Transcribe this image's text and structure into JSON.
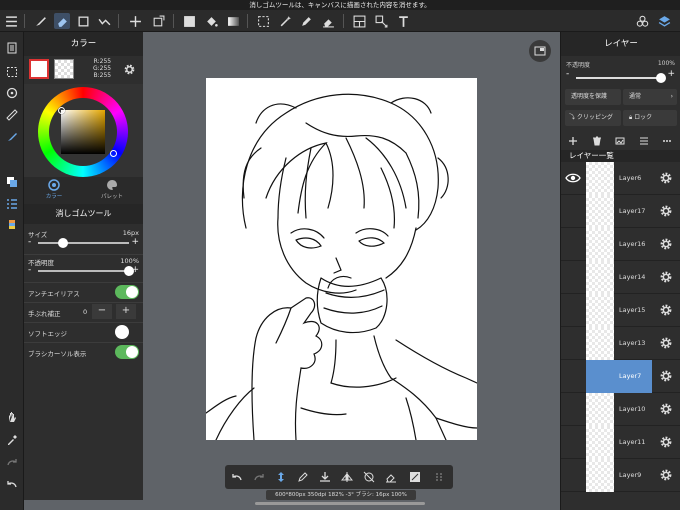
{
  "notice": "消しゴムツールは、キャンバスに描画された内容を消せます。",
  "toolbar": {
    "left_icons": [
      "menu-icon",
      "brush-icon",
      "eraser-icon",
      "shape-icon",
      "dot-tool-icon",
      "move-icon",
      "transform-icon",
      "fill-color-icon",
      "bucket-icon",
      "gradient-icon",
      "select-icon",
      "magic-wand-icon",
      "select-pen-icon",
      "select-eraser-icon",
      "frame-icon",
      "transform-alt-icon",
      "text-icon"
    ],
    "right_icons": [
      "materials-icon",
      "layers-icon"
    ]
  },
  "left_sidebar": [
    "layer-icon",
    "selection-icon",
    "redo-history-icon",
    "ruler-icon",
    "brush-settings-icon",
    "color-square-icon",
    "list-icon",
    "palette-icon",
    "hand-icon",
    "eyedropper-icon",
    "redo-icon",
    "undo-icon"
  ],
  "color_panel": {
    "title": "カラー",
    "main_color": "#ffffff",
    "r": "R:255",
    "g": "G:255",
    "b": "B:255",
    "tab_color": "カラー",
    "tab_palette": "パレット"
  },
  "tool_panel": {
    "title": "消しゴムツール",
    "size_label": "サイズ",
    "size_value": "16px",
    "size_fraction": 0.27,
    "opacity_label": "不透明度",
    "opacity_value": "100%",
    "opacity_fraction": 1.0,
    "antialias_label": "アンチエイリアス",
    "antialias_on": true,
    "stabilizer_label": "手ぶれ補正",
    "stabilizer_value": "0",
    "soft_edge_label": "ソフトエッジ",
    "soft_edge_on": false,
    "brush_cursor_label": "ブラシカーソル表示",
    "brush_cursor_on": true
  },
  "canvas": {
    "status": "600*800px 350dpi 182% -3° ブラシ: 16px 100%"
  },
  "layer_panel": {
    "title": "レイヤー",
    "opacity_label": "不透明度",
    "opacity_value": "100%",
    "protect_alpha": "透明度を保護",
    "blend_mode": "通常",
    "clipping": "クリッピング",
    "lock": "ロック",
    "list_title": "レイヤー一覧",
    "layers": [
      {
        "name": "Layer6"
      },
      {
        "name": "Layer17"
      },
      {
        "name": "Layer16"
      },
      {
        "name": "Layer14"
      },
      {
        "name": "Layer15"
      },
      {
        "name": "Layer13"
      },
      {
        "name": "Layer7",
        "selected": true
      },
      {
        "name": "Layer10"
      },
      {
        "name": "Layer11"
      },
      {
        "name": "Layer9"
      }
    ]
  },
  "colors": {
    "accent_selected": "#5a8fce",
    "toggle_on": "#5cb85c",
    "panel_bg": "#2e2e2e",
    "canvas_bg": "#5f6368"
  }
}
